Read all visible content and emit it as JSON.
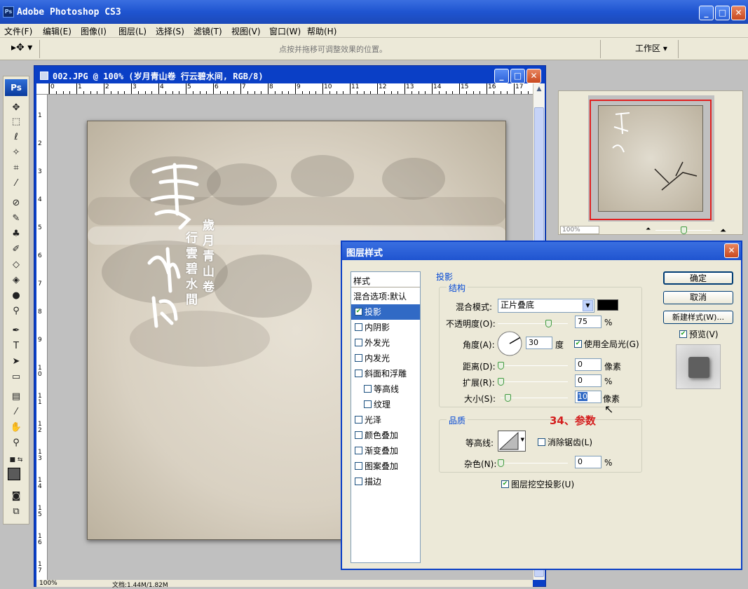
{
  "app": {
    "icon": "Ps",
    "title": "Adobe Photoshop CS3"
  },
  "menu": [
    "文件(F)",
    "编辑(E)",
    "图像(I)",
    "图层(L)",
    "选择(S)",
    "滤镜(T)",
    "视图(V)",
    "窗口(W)",
    "帮助(H)"
  ],
  "options_bar": {
    "hint": "点按并拖移可调整效果的位置。",
    "workspace_label": "工作区 ▾"
  },
  "toolbox": {
    "logo": "Ps"
  },
  "document": {
    "title": "002.JPG @ 100% (岁月青山卷  行云碧水间, RGB/8)",
    "ruler_h": [
      "0",
      "1",
      "2",
      "3",
      "4",
      "5",
      "6",
      "7",
      "8",
      "9",
      "10",
      "11",
      "12",
      "13",
      "14",
      "15",
      "16",
      "17"
    ],
    "ruler_v": [
      "1",
      "2",
      "3",
      "4",
      "5",
      "6",
      "7",
      "8",
      "9",
      "1\n0",
      "1\n1",
      "1\n2",
      "1\n3",
      "1\n4",
      "1\n5",
      "1\n6",
      "1\n7"
    ],
    "zoom": "100%",
    "doc_size": "文档:1.44M/1.82M",
    "poem_col1": "行雲碧水間",
    "poem_col2": "歲月青山卷"
  },
  "navigator": {
    "zoom": "100%"
  },
  "dialog": {
    "title": "图层样式",
    "styles_header": "样式",
    "styles": [
      {
        "label": "混合选项:默认",
        "checkbox": false,
        "checked": false,
        "indent": false,
        "selected": false
      },
      {
        "label": "投影",
        "checkbox": true,
        "checked": true,
        "indent": false,
        "selected": true
      },
      {
        "label": "内阴影",
        "checkbox": true,
        "checked": false,
        "indent": false,
        "selected": false
      },
      {
        "label": "外发光",
        "checkbox": true,
        "checked": false,
        "indent": false,
        "selected": false
      },
      {
        "label": "内发光",
        "checkbox": true,
        "checked": false,
        "indent": false,
        "selected": false
      },
      {
        "label": "斜面和浮雕",
        "checkbox": true,
        "checked": false,
        "indent": false,
        "selected": false
      },
      {
        "label": "等高线",
        "checkbox": true,
        "checked": false,
        "indent": true,
        "selected": false
      },
      {
        "label": "纹理",
        "checkbox": true,
        "checked": false,
        "indent": true,
        "selected": false
      },
      {
        "label": "光泽",
        "checkbox": true,
        "checked": false,
        "indent": false,
        "selected": false
      },
      {
        "label": "颜色叠加",
        "checkbox": true,
        "checked": false,
        "indent": false,
        "selected": false
      },
      {
        "label": "渐变叠加",
        "checkbox": true,
        "checked": false,
        "indent": false,
        "selected": false
      },
      {
        "label": "图案叠加",
        "checkbox": true,
        "checked": false,
        "indent": false,
        "selected": false
      },
      {
        "label": "描边",
        "checkbox": true,
        "checked": false,
        "indent": false,
        "selected": false
      }
    ],
    "section_title": "投影",
    "structure_title": "结构",
    "blend_mode_label": "混合模式:",
    "blend_mode_value": "正片叠底",
    "blend_color": "#000000",
    "opacity_label": "不透明度(O):",
    "opacity_value": "75",
    "opacity_unit": "%",
    "opacity_level": 0.75,
    "angle_label": "角度(A):",
    "angle_value": "30",
    "angle_unit": "度",
    "global_light_label": "使用全局光(G)",
    "global_light_checked": true,
    "distance_label": "距离(D):",
    "distance_value": "0",
    "distance_unit": "像素",
    "spread_label": "扩展(R):",
    "spread_value": "0",
    "spread_unit": "%",
    "size_label": "大小(S):",
    "size_value": "10",
    "size_unit": "像素",
    "quality_title": "品质",
    "contour_label": "等高线:",
    "antialias_label": "消除锯齿(L)",
    "noise_label": "杂色(N):",
    "noise_value": "0",
    "noise_unit": "%",
    "knockout_label": "图层挖空投影(U)",
    "ok_label": "确定",
    "cancel_label": "取消",
    "new_style_label": "新建样式(W)...",
    "preview_label": "预览(V)"
  },
  "annotation": "34、参数"
}
